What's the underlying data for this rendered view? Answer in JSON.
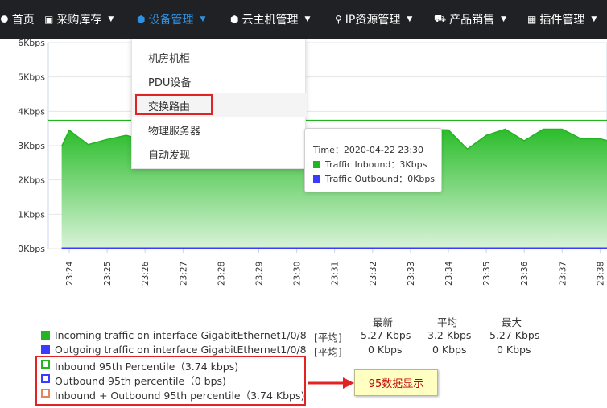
{
  "nav": {
    "items": [
      {
        "label": "首页",
        "icon": "home-icon"
      },
      {
        "label": "采购库存",
        "icon": "hdd-icon"
      },
      {
        "label": "设备管理",
        "icon": "cube-icon",
        "active": true
      },
      {
        "label": "云主机管理",
        "icon": "cube-icon"
      },
      {
        "label": "IP资源管理",
        "icon": "map-marker-icon"
      },
      {
        "label": "产品销售",
        "icon": "cart-icon"
      },
      {
        "label": "插件管理",
        "icon": "grid-icon"
      }
    ]
  },
  "dropdown": {
    "items": [
      "机房机柜",
      "PDU设备",
      "交换路由",
      "物理服务器",
      "自动发现"
    ],
    "highlighted_index": 2
  },
  "tooltip": {
    "time": "Time：2020-04-22 23:30",
    "inbound": "Traffic Inbound：3Kbps",
    "outbound": "Traffic Outbound：0Kbps"
  },
  "chart_data": {
    "type": "area",
    "y_ticks": [
      "6Kbps",
      "5Kbps",
      "4Kbps",
      "3Kbps",
      "2Kbps",
      "1Kbps",
      "0Kbps"
    ],
    "ylim": [
      0,
      6
    ],
    "x_ticks": [
      "23:24",
      "23:25",
      "23:26",
      "23:27",
      "23:28",
      "23:29",
      "23:30",
      "23:31",
      "23:32",
      "23:33",
      "23:34",
      "23:35",
      "23:36",
      "23:37",
      "23:38"
    ],
    "percentile_line": 3.74,
    "series": [
      {
        "key": "inbound",
        "color": "#22b422",
        "x": [
          "23:23:48",
          "23:24:00",
          "23:24:30",
          "23:25:00",
          "23:25:30",
          "23:26:00",
          "23:26:30",
          "23:27:00",
          "23:27:30",
          "23:28:00",
          "23:28:30",
          "23:29:00",
          "23:29:30",
          "23:30:00",
          "23:30:30",
          "23:31:00",
          "23:31:30",
          "23:32:00",
          "23:32:30",
          "23:33:00",
          "23:33:30",
          "23:34:00",
          "23:34:30",
          "23:35:00",
          "23:35:30",
          "23:36:00",
          "23:36:30",
          "23:37:00",
          "23:37:30",
          "23:38:00",
          "23:38:20"
        ],
        "values": [
          2.98,
          3.45,
          3.03,
          3.18,
          3.3,
          3.15,
          3.2,
          3.25,
          3.3,
          3.2,
          3.3,
          3.25,
          3.3,
          3.2,
          3.3,
          3.4,
          3.35,
          3.4,
          3.3,
          3.45,
          3.46,
          3.46,
          2.9,
          3.3,
          3.48,
          3.14,
          3.48,
          3.48,
          3.2,
          3.2,
          3.1
        ]
      },
      {
        "key": "outbound",
        "color": "#3b3bff",
        "x": [
          "23:23:48",
          "23:38:20"
        ],
        "values": [
          0,
          0
        ]
      }
    ]
  },
  "legend": {
    "headers": [
      "最新",
      "平均",
      "最大"
    ],
    "rows": [
      {
        "label": "Incoming traffic on interface GigabitEthernet1/0/8",
        "tag": "[平均]",
        "latest": "5.27 Kbps",
        "avg": "3.2 Kbps",
        "max": "5.27 Kbps",
        "color": "#22b422"
      },
      {
        "label": "Outgoing traffic on interface GigabitEthernet1/0/8",
        "tag": "[平均]",
        "latest": "0 Kbps",
        "avg": "0 Kbps",
        "max": "0 Kbps",
        "color": "#3b3bff"
      }
    ],
    "percentiles": [
      {
        "label": "Inbound 95th Percentile（3.74 kbps)",
        "color": "#22b422"
      },
      {
        "label": "Outbound 95th percentile（0 bps)",
        "color": "#3b3bff"
      },
      {
        "label": "Inbound + Outbound 95th percentile（3.74 Kbps)",
        "color": "#e8835a"
      }
    ]
  },
  "callout": {
    "text": "95数据显示"
  }
}
